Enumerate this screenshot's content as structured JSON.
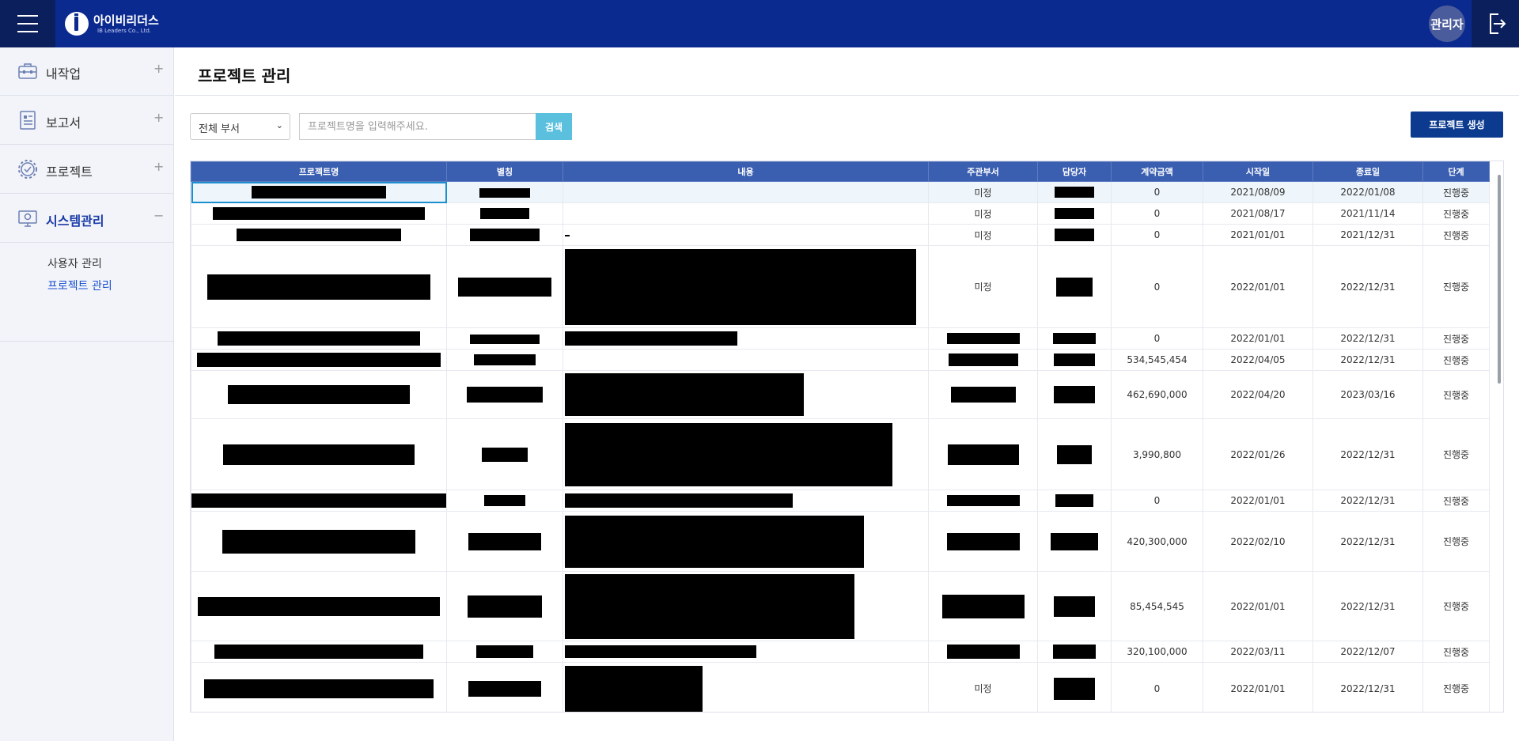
{
  "app": {
    "logo_name": "아이비리더스",
    "logo_sub": "IB Leaders Co., Ltd.",
    "user_badge": "관리자"
  },
  "sidebar": {
    "menus": [
      {
        "label": "내작업",
        "toggle": "+",
        "icon": "briefcase-icon"
      },
      {
        "label": "보고서",
        "toggle": "+",
        "icon": "report-icon"
      },
      {
        "label": "프로젝트",
        "toggle": "+",
        "icon": "gear-check-icon"
      },
      {
        "label": "시스템관리",
        "toggle": "−",
        "icon": "monitor-gear-icon"
      }
    ],
    "submenu": [
      {
        "label": "사용자 관리"
      },
      {
        "label": "프로젝트 관리"
      }
    ]
  },
  "page": {
    "title": "프로젝트 관리",
    "department_select": "전체 부서",
    "search_placeholder": "프로젝트명을 입력해주세요.",
    "search_button": "검색",
    "create_button": "프로젝트 생성"
  },
  "table": {
    "headers": [
      "프로젝트명",
      "별칭",
      "내용",
      "주관부서",
      "담당자",
      "계약금액",
      "시작일",
      "종료일",
      "단계"
    ],
    "rows": [
      {
        "dept": "미정",
        "amount": "0",
        "start": "2021/08/09",
        "end": "2022/01/08",
        "stage": "진행중"
      },
      {
        "dept": "미정",
        "amount": "0",
        "start": "2021/08/17",
        "end": "2021/11/14",
        "stage": "진행중"
      },
      {
        "dept": "미정",
        "amount": "0",
        "start": "2021/01/01",
        "end": "2021/12/31",
        "stage": "진행중"
      },
      {
        "dept": "미정",
        "amount": "0",
        "start": "2022/01/01",
        "end": "2022/12/31",
        "stage": "진행중"
      },
      {
        "dept": "",
        "amount": "0",
        "start": "2022/01/01",
        "end": "2022/12/31",
        "stage": "진행중"
      },
      {
        "dept": "",
        "amount": "534,545,454",
        "start": "2022/04/05",
        "end": "2022/12/31",
        "stage": "진행중"
      },
      {
        "dept": "",
        "amount": "462,690,000",
        "start": "2022/04/20",
        "end": "2023/03/16",
        "stage": "진행중"
      },
      {
        "dept": "",
        "amount": "3,990,800",
        "start": "2022/01/26",
        "end": "2022/12/31",
        "stage": "진행중"
      },
      {
        "dept": "",
        "amount": "0",
        "start": "2022/01/01",
        "end": "2022/12/31",
        "stage": "진행중"
      },
      {
        "dept": "",
        "amount": "420,300,000",
        "start": "2022/02/10",
        "end": "2022/12/31",
        "stage": "진행중"
      },
      {
        "dept": "",
        "amount": "85,454,545",
        "start": "2022/01/01",
        "end": "2022/12/31",
        "stage": "진행중"
      },
      {
        "dept": "",
        "amount": "320,100,000",
        "start": "2022/03/11",
        "end": "2022/12/07",
        "stage": "진행중"
      },
      {
        "dept": "미정",
        "amount": "0",
        "start": "2022/01/01",
        "end": "2022/12/31",
        "stage": "진행중"
      }
    ]
  }
}
